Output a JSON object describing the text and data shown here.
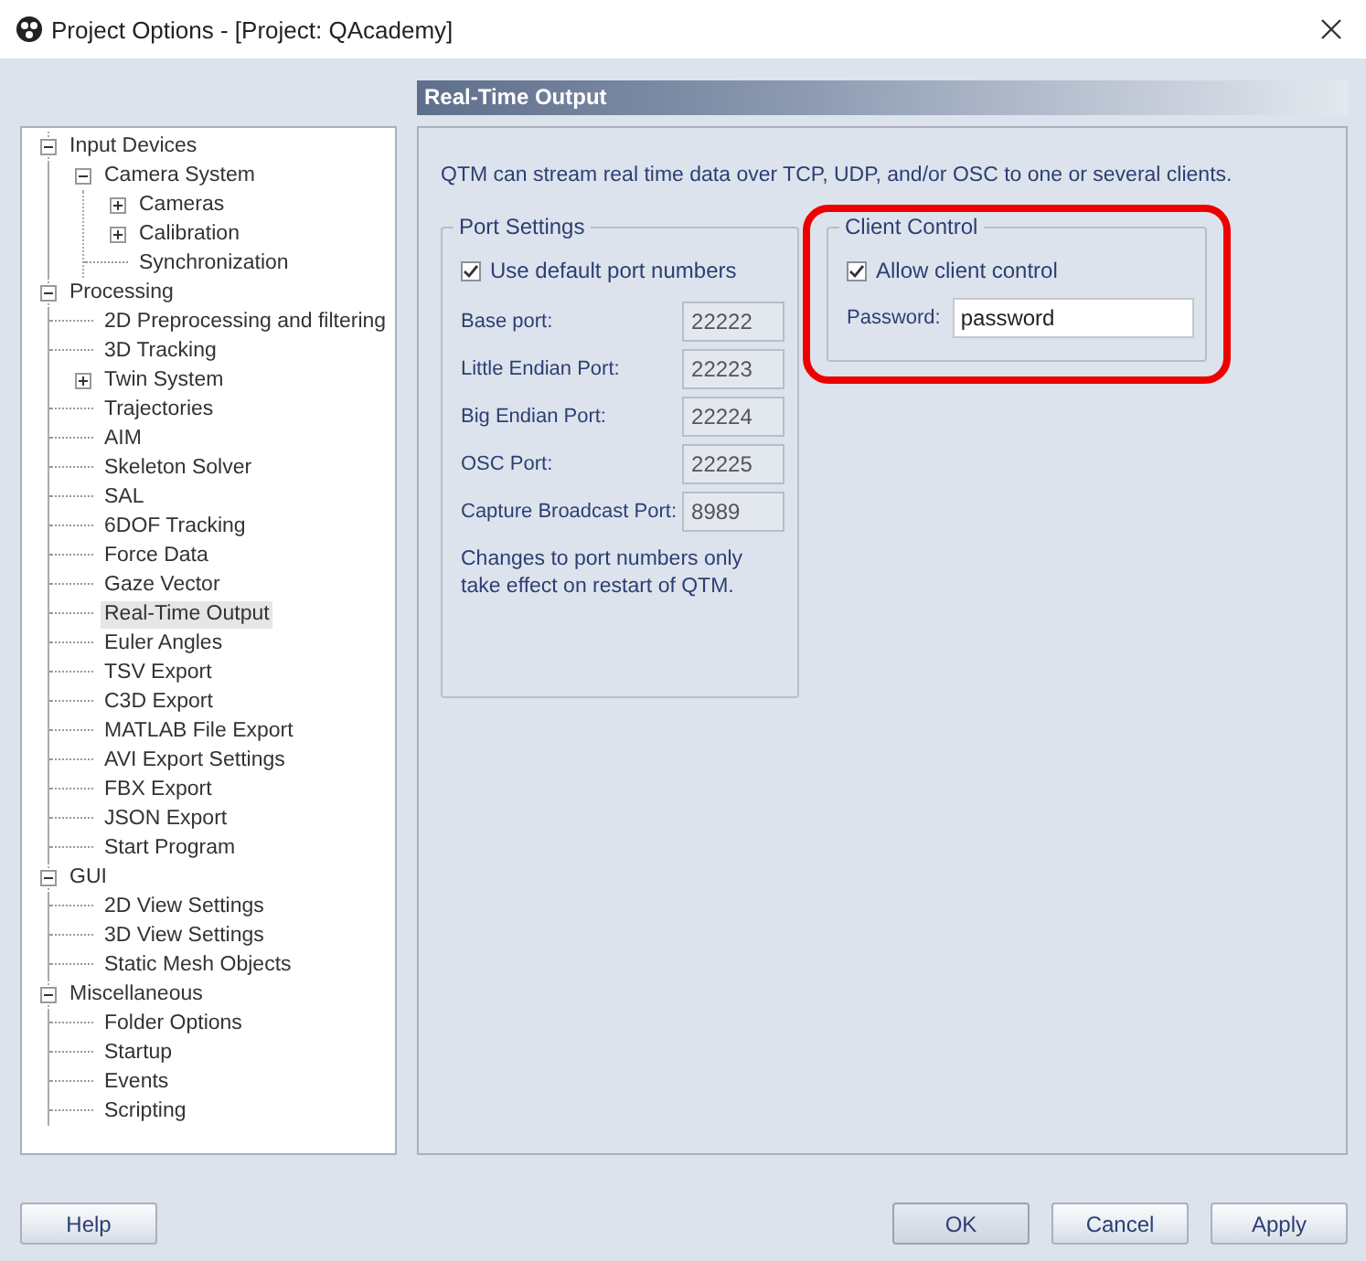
{
  "window": {
    "title": "Project Options - [Project: QAcademy]"
  },
  "tree": [
    {
      "label": "Input Devices",
      "expanded": true,
      "selected": false,
      "children": [
        {
          "label": "Camera System",
          "expanded": true,
          "selected": false,
          "children": [
            {
              "label": "Cameras",
              "expanded": false,
              "selected": false
            },
            {
              "label": "Calibration",
              "expanded": false,
              "selected": false
            },
            {
              "label": "Synchronization",
              "selected": false
            }
          ]
        }
      ]
    },
    {
      "label": "Processing",
      "expanded": true,
      "selected": false,
      "children": [
        {
          "label": "2D Preprocessing and filtering",
          "selected": false
        },
        {
          "label": "3D Tracking",
          "selected": false
        },
        {
          "label": "Twin System",
          "expanded": false,
          "selected": false
        },
        {
          "label": "Trajectories",
          "selected": false
        },
        {
          "label": "AIM",
          "selected": false
        },
        {
          "label": "Skeleton Solver",
          "selected": false
        },
        {
          "label": "SAL",
          "selected": false
        },
        {
          "label": "6DOF Tracking",
          "selected": false
        },
        {
          "label": "Force Data",
          "selected": false
        },
        {
          "label": "Gaze Vector",
          "selected": false
        },
        {
          "label": "Real-Time Output",
          "selected": true
        },
        {
          "label": "Euler Angles",
          "selected": false
        },
        {
          "label": "TSV Export",
          "selected": false
        },
        {
          "label": "C3D Export",
          "selected": false
        },
        {
          "label": "MATLAB File Export",
          "selected": false
        },
        {
          "label": "AVI Export Settings",
          "selected": false
        },
        {
          "label": "FBX Export",
          "selected": false
        },
        {
          "label": "JSON Export",
          "selected": false
        },
        {
          "label": "Start Program",
          "selected": false
        }
      ]
    },
    {
      "label": "GUI",
      "expanded": true,
      "selected": false,
      "children": [
        {
          "label": "2D View Settings",
          "selected": false
        },
        {
          "label": "3D View Settings",
          "selected": false
        },
        {
          "label": "Static Mesh Objects",
          "selected": false
        }
      ]
    },
    {
      "label": "Miscellaneous",
      "expanded": true,
      "selected": false,
      "children": [
        {
          "label": "Folder Options",
          "selected": false
        },
        {
          "label": "Startup",
          "selected": false
        },
        {
          "label": "Events",
          "selected": false
        },
        {
          "label": "Scripting",
          "selected": false
        }
      ]
    }
  ],
  "page": {
    "header": "Real-Time Output",
    "description": "QTM can stream real time data over TCP, UDP, and/or OSC to one or several clients.",
    "port_settings": {
      "title": "Port Settings",
      "use_default": {
        "label": "Use default port numbers",
        "checked": true
      },
      "ports": [
        {
          "label": "Base port:",
          "value": "22222"
        },
        {
          "label": "Little Endian Port:",
          "value": "22223"
        },
        {
          "label": "Big Endian Port:",
          "value": "22224"
        },
        {
          "label": "OSC Port:",
          "value": "22225"
        },
        {
          "label": "Capture Broadcast Port:",
          "value": "8989"
        }
      ],
      "note": "Changes to port numbers only take effect on restart of QTM."
    },
    "client_control": {
      "title": "Client Control",
      "highlighted": true,
      "allow": {
        "label": "Allow client control",
        "checked": true
      },
      "password": {
        "label": "Password:",
        "value": "password"
      }
    }
  },
  "buttons": [
    {
      "label": "Help",
      "kind": "secondary"
    },
    {
      "label": "OK",
      "kind": "default"
    },
    {
      "label": "Cancel",
      "kind": "secondary"
    },
    {
      "label": "Apply",
      "kind": "secondary"
    }
  ]
}
